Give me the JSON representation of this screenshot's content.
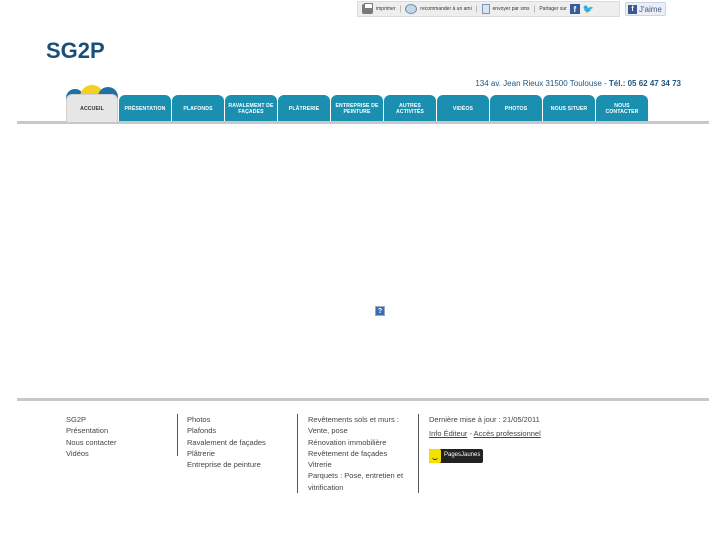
{
  "share_bar": {
    "print": "imprimer",
    "recommend": "recommander à un ami",
    "send": "envoyer par sms",
    "share_on": "Partager sur",
    "facebook_letter": "f",
    "like": "J'aime"
  },
  "header": {
    "title": "SG2P",
    "address": "134 av. Jean Rieux 31500 Toulouse",
    "address_sep": "-",
    "tel_label": "Tél.:",
    "tel": "05 62 47 34 73"
  },
  "nav": {
    "items": [
      {
        "label": "ACCUEIL",
        "active": true
      },
      {
        "label": "PRÉSENTATION"
      },
      {
        "label": "PLAFONDS"
      },
      {
        "label": "RAVALEMENT DE FAÇADES"
      },
      {
        "label": "PLÂTRERIE"
      },
      {
        "label": "ENTREPRISE DE PEINTURE"
      },
      {
        "label": "AUTRES ACTIVITÉS"
      },
      {
        "label": "VIDÉOS"
      },
      {
        "label": "PHOTOS"
      },
      {
        "label": "NOUS SITUER"
      },
      {
        "label": "NOUS CONTACTER"
      }
    ]
  },
  "content": {
    "missing_image_glyph": "?"
  },
  "footer": {
    "col1": [
      "SG2P",
      "Présentation",
      "Nous contacter",
      "Vidéos"
    ],
    "col2": [
      "Photos",
      "Plafonds",
      "Ravalement de façades",
      "Plâtrerie",
      "Entreprise de peinture"
    ],
    "col3": [
      "Revêtements sols et murs :",
      "Vente, pose",
      "Rénovation immobilière",
      "Revêtement de façades",
      "Vitrerie",
      "Parquets : Pose, entretien et vitrification"
    ],
    "last_update": "Dernière mise à jour : 21/05/2011",
    "info_editor": "Info Éditeur",
    "link_sep": "-",
    "pro_access": "Accès professionnel",
    "pages_jaunes": "PagesJaunes"
  },
  "colors": {
    "brand": "#1a4f7a",
    "nav_tab": "#1a8fb0",
    "logo_yellow": "#f5cf1f"
  }
}
